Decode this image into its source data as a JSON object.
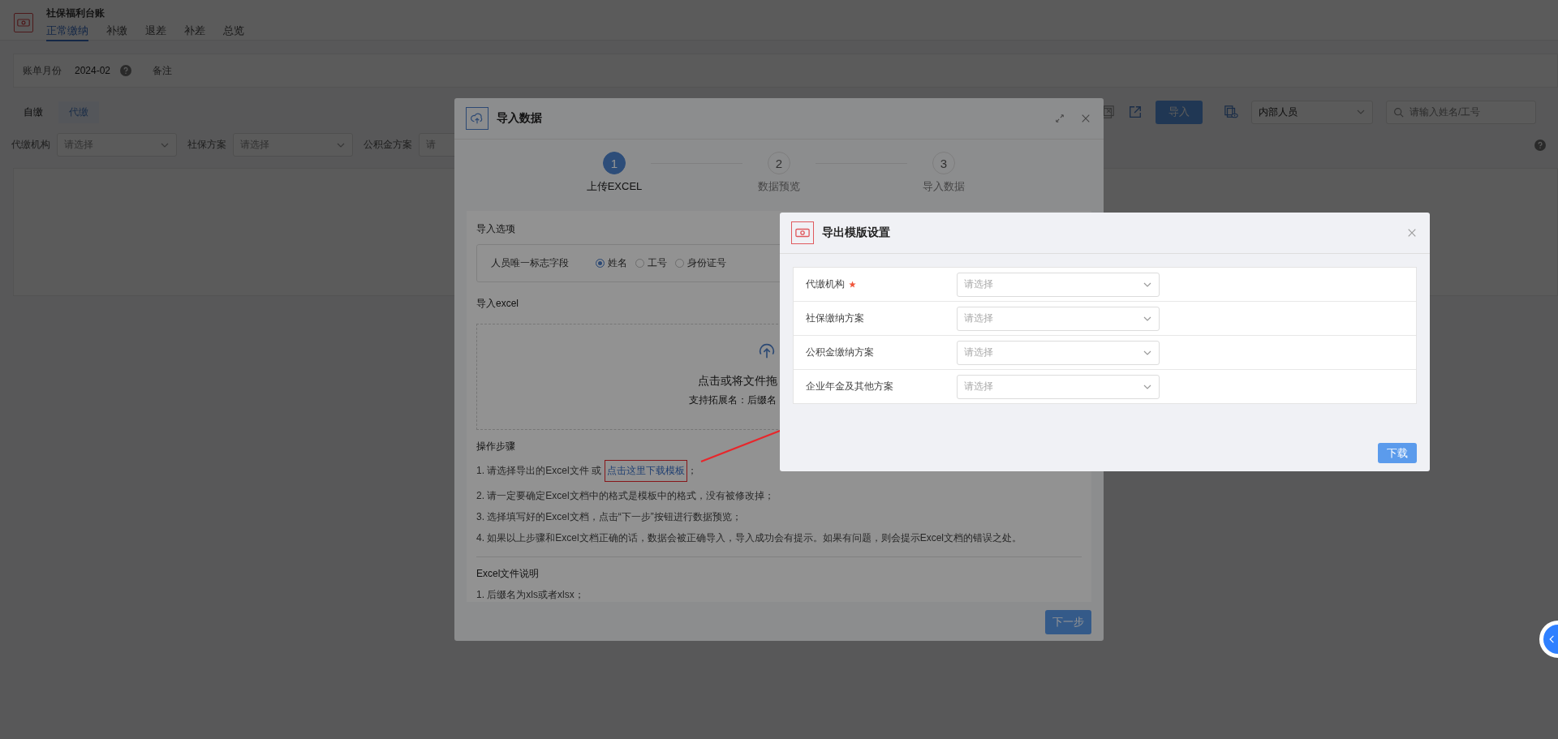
{
  "app": {
    "title": "社保福利台账",
    "tabs": [
      {
        "label": "正常缴纳",
        "selected": true
      },
      {
        "label": "补缴",
        "selected": false
      },
      {
        "label": "退差",
        "selected": false
      },
      {
        "label": "补差",
        "selected": false
      },
      {
        "label": "总览",
        "selected": false
      }
    ]
  },
  "bill": {
    "month_label": "账单月份",
    "month": "2024-02",
    "note_label": "备注"
  },
  "pay_tabs": [
    {
      "label": "自缴",
      "selected": false
    },
    {
      "label": "代缴",
      "selected": true
    }
  ],
  "filters": [
    {
      "label": "代缴机构",
      "placeholder": "请选择"
    },
    {
      "label": "社保方案",
      "placeholder": "请选择"
    },
    {
      "label": "公积金方案",
      "placeholder": "请"
    }
  ],
  "toolbar": {
    "import_button": "导入",
    "person_type": "内部人员",
    "search_placeholder": "请输入姓名/工号"
  },
  "import_dialog": {
    "title": "导入数据",
    "steps": [
      {
        "number": "1",
        "label": "上传EXCEL",
        "selected": true
      },
      {
        "number": "2",
        "label": "数据预览",
        "selected": false
      },
      {
        "number": "3",
        "label": "导入数据",
        "selected": false
      }
    ],
    "options_title": "导入选项",
    "id_field_label": "人员唯一标志字段",
    "id_options": [
      {
        "label": "姓名",
        "selected": true
      },
      {
        "label": "工号",
        "selected": false
      },
      {
        "label": "身份证号",
        "selected": false
      }
    ],
    "excel_title": "导入excel",
    "upload_text": "点击或将文件拖",
    "upload_hint": "支持拓展名：后缀名",
    "steps_title": "操作步骤",
    "first_step": "1. 请选择导出的Excel文件 或",
    "template_link": {
      "text": "点击这里下载模板",
      "highlighted": true
    },
    "first_step_end": "；",
    "instructions": [
      "2. 请一定要确定Excel文档中的格式是模板中的格式，没有被修改掉；",
      "3. 选择填写好的Excel文档，点击“下一步”按钮进行数据预览；",
      "4. 如果以上步骤和Excel文档正确的话，数据会被正确导入，导入成功会有提示。如果有问题，则会提示Excel文档的错误之处。"
    ],
    "file_notes_title": "Excel文件说明",
    "file_notes": [
      "1. 后缀名为xls或者xlsx；"
    ],
    "next_button": "下一步"
  },
  "export_dialog": {
    "title": "导出模版设置",
    "fields": [
      {
        "label": "代缴机构",
        "required": true,
        "placeholder": "请选择"
      },
      {
        "label": "社保缴纳方案",
        "required": false,
        "placeholder": "请选择"
      },
      {
        "label": "公积金缴纳方案",
        "required": false,
        "placeholder": "请选择"
      },
      {
        "label": "企业年金及其他方案",
        "required": false,
        "placeholder": "请选择"
      }
    ],
    "download_button": "下载"
  }
}
